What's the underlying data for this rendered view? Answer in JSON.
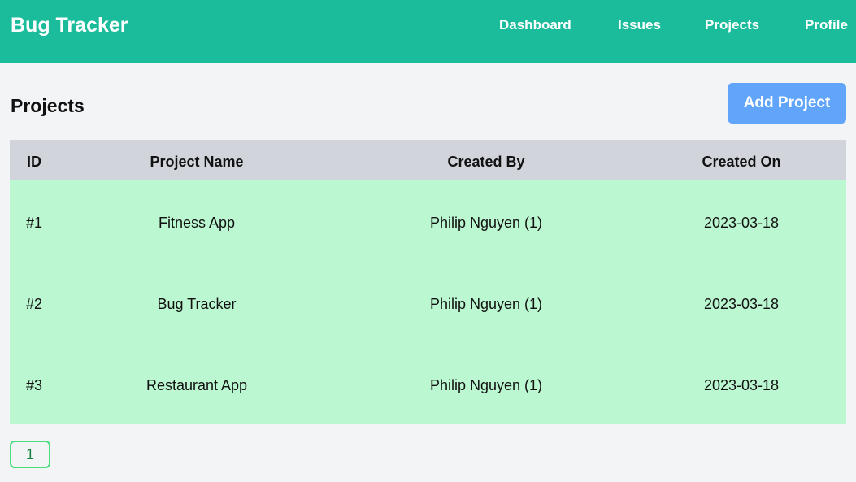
{
  "header": {
    "brand": "Bug Tracker",
    "nav": {
      "dashboard": "Dashboard",
      "issues": "Issues",
      "projects": "Projects",
      "profile": "Profile"
    }
  },
  "page": {
    "title": "Projects",
    "add_button_label": "Add Project"
  },
  "table": {
    "columns": {
      "id": "ID",
      "name": "Project Name",
      "created_by": "Created By",
      "created_on": "Created On"
    },
    "rows": [
      {
        "id": "#1",
        "name": "Fitness App",
        "created_by": "Philip Nguyen (1)",
        "created_on": "2023-03-18"
      },
      {
        "id": "#2",
        "name": "Bug Tracker",
        "created_by": "Philip Nguyen (1)",
        "created_on": "2023-03-18"
      },
      {
        "id": "#3",
        "name": "Restaurant App",
        "created_by": "Philip Nguyen (1)",
        "created_on": "2023-03-18"
      }
    ]
  },
  "pagination": {
    "pages": [
      "1"
    ]
  },
  "colors": {
    "header_bg": "#1abc9c",
    "button_bg": "#60a5fa",
    "table_header_bg": "#d1d5db",
    "table_body_bg": "#bbf7d0",
    "pager_border": "#4ade80"
  }
}
